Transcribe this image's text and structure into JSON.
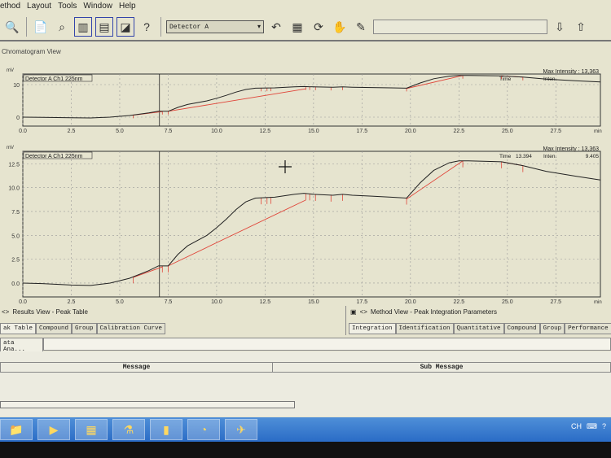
{
  "menu": [
    "ethod",
    "Layout",
    "Tools",
    "Window",
    "Help"
  ],
  "toolbar": {
    "detector": "Detector A",
    "help": "?"
  },
  "view_title": "Chromatogram View",
  "charts": [
    {
      "label": "Detector A Ch1 225nm",
      "yunit": "mV",
      "xunit": "min",
      "max_intensity": "Max Intensity : 13,363",
      "time_label": "Time",
      "inten_label": "Inten.",
      "time_value": "",
      "inten_value": "",
      "yticks": [
        0,
        10
      ],
      "ylim": [
        -2.75,
        13.25
      ]
    },
    {
      "label": "Detector A Ch1 225nm",
      "yunit": "mV",
      "xunit": "min",
      "max_intensity": "Max Intensity : 13,363",
      "time_label": "Time",
      "inten_label": "Inten.",
      "time_value": "13.394",
      "inten_value": "9.405",
      "yticks": [
        0.0,
        2.5,
        5.0,
        7.5,
        10.0,
        12.5
      ],
      "ylim": [
        -1.45,
        13.8
      ]
    }
  ],
  "chart_data": {
    "type": "line",
    "xlabel": "min",
    "ylabel": "mV",
    "xlim": [
      0,
      29.8
    ],
    "xticks": [
      0.0,
      2.5,
      5.0,
      7.5,
      10.0,
      12.5,
      15.0,
      17.5,
      20.0,
      22.5,
      25.0,
      27.5
    ],
    "cursor_x": 7.05,
    "signal": [
      [
        0,
        0
      ],
      [
        1,
        -0.05
      ],
      [
        2.5,
        -0.2
      ],
      [
        3.5,
        -0.25
      ],
      [
        4.5,
        0
      ],
      [
        5.5,
        0.5
      ],
      [
        6.5,
        1.3
      ],
      [
        7,
        1.8
      ],
      [
        7.5,
        1.8
      ],
      [
        8,
        3
      ],
      [
        8.5,
        3.9
      ],
      [
        9.5,
        5
      ],
      [
        10,
        5.8
      ],
      [
        10.5,
        6.7
      ],
      [
        11,
        7.7
      ],
      [
        11.5,
        8.5
      ],
      [
        12,
        8.9
      ],
      [
        13,
        9
      ],
      [
        14,
        9.3
      ],
      [
        14.5,
        9.4
      ],
      [
        15,
        9.3
      ],
      [
        16,
        9.2
      ],
      [
        16.5,
        9.3
      ],
      [
        17,
        9.2
      ],
      [
        18,
        9.1
      ],
      [
        19,
        9.0
      ],
      [
        19.8,
        8.9
      ],
      [
        20.5,
        10.5
      ],
      [
        21.2,
        11.8
      ],
      [
        22,
        12.6
      ],
      [
        22.5,
        12.8
      ],
      [
        23,
        12.8
      ],
      [
        24.7,
        12.7
      ],
      [
        25.8,
        12.3
      ],
      [
        27,
        11.7
      ],
      [
        28.5,
        11.2
      ],
      [
        29.8,
        10.8
      ]
    ],
    "baselines": [
      [
        [
          5.7,
          0.6
        ],
        [
          7.2,
          1.7
        ]
      ],
      [
        [
          7.5,
          1.8
        ],
        [
          14.6,
          8.7
        ]
      ],
      [
        [
          19.8,
          8.8
        ],
        [
          22.7,
          12.8
        ]
      ],
      [
        [
          24.7,
          12.7
        ],
        [
          25.8,
          12.3
        ]
      ]
    ],
    "peak_marks": [
      5.7,
      7.2,
      7.5,
      12.3,
      12.6,
      12.8,
      14.6,
      14.8,
      15.1,
      15.9,
      16.5,
      19.8,
      22.7,
      24.7,
      25.8
    ]
  },
  "results": {
    "title": "Results View - Peak Table",
    "tabs": [
      "ak Table",
      "Compound",
      "Group",
      "Calibration Curve"
    ],
    "subtab": "ata Ana..."
  },
  "method": {
    "title": "Method View - Peak Integration Parameters",
    "tabs": [
      "Integration",
      "Identification",
      "Quantitative",
      "Compound",
      "Group",
      "Performance"
    ]
  },
  "messages": {
    "col1": "Message",
    "col2": "Sub Message"
  },
  "tray": {
    "lang": "CH"
  },
  "colors": {
    "baseline": "#e0463a",
    "signal": "#222222",
    "taskbar": "#2a6cc6"
  }
}
